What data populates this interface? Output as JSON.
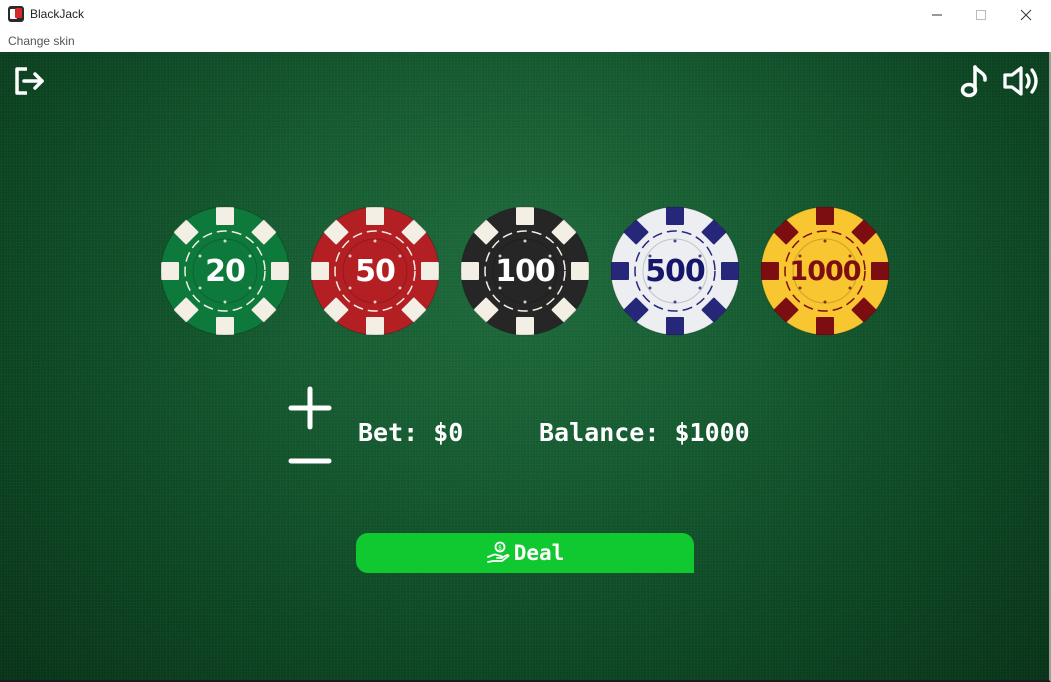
{
  "window": {
    "title": "BlackJack",
    "controls": [
      "minimize",
      "maximize",
      "close"
    ]
  },
  "menu": {
    "items": [
      {
        "label": "Change skin"
      }
    ]
  },
  "toolbar": {
    "left": [
      "logout-icon"
    ],
    "right": [
      "music-note-icon",
      "volume-icon"
    ]
  },
  "chips": [
    {
      "label": "20",
      "base": "#0d7a3c",
      "stripe": "#f3efe4",
      "text": "#ffffff"
    },
    {
      "label": "50",
      "base": "#b41f24",
      "stripe": "#f3efe4",
      "text": "#ffffff"
    },
    {
      "label": "100",
      "base": "#262626",
      "stripe": "#f3efe4",
      "text": "#ffffff"
    },
    {
      "label": "500",
      "base": "#eceef2",
      "stripe": "#27277a",
      "text": "#16166a"
    },
    {
      "label": "1000",
      "base": "#f8c630",
      "stripe": "#7c0e12",
      "text": "#7c0e12"
    }
  ],
  "bet": {
    "label": "Bet: $0",
    "increase_icon": "plus-icon",
    "decrease_icon": "minus-icon"
  },
  "balance": {
    "label": "Balance: $1000"
  },
  "deal": {
    "label": "Deal",
    "icon": "hand-coin-icon"
  },
  "colors": {
    "felt": "#155a30",
    "deal_button": "#10c930",
    "text": "#ffffff"
  }
}
